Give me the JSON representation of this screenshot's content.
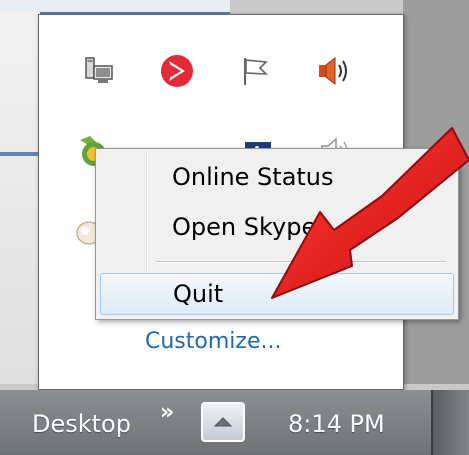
{
  "tray": {
    "customize_label": "Customize...",
    "icons": [
      {
        "name": "network-icon"
      },
      {
        "name": "red-arrow-app-icon"
      },
      {
        "name": "action-center-flag-icon"
      },
      {
        "name": "volume-icon"
      },
      {
        "name": "skype-icon"
      },
      {
        "name": "green-app-icon"
      },
      {
        "name": "blue-app-icon"
      },
      {
        "name": "speaker-outline-icon"
      },
      {
        "name": "balloon-icon"
      }
    ]
  },
  "context_menu": {
    "items": [
      {
        "label": "Online Status"
      },
      {
        "label": "Open Skype"
      },
      {
        "label": "Quit",
        "highlighted": true
      }
    ]
  },
  "taskbar": {
    "desktop_label": "Desktop",
    "chevron": "»",
    "clock": "8:14 PM"
  },
  "colors": {
    "arrow": "#e8181b",
    "link": "#1d69b3",
    "highlight_border": "#a8c8eb"
  }
}
